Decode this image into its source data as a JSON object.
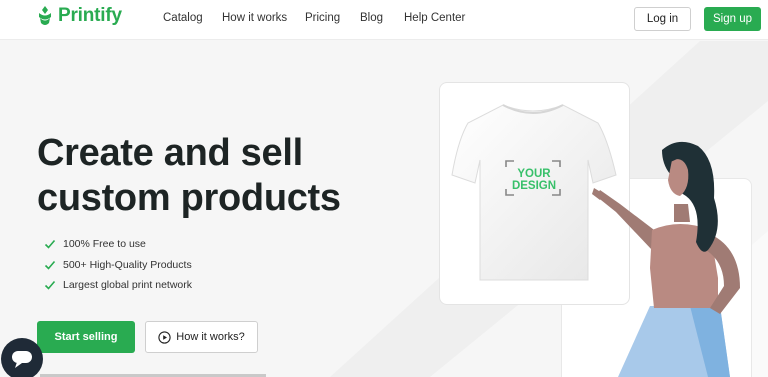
{
  "brand": {
    "name": "Printify",
    "accent": "#29ab51"
  },
  "nav": {
    "items": [
      "Catalog",
      "How it works",
      "Pricing",
      "Blog",
      "Help Center"
    ],
    "login_label": "Log in",
    "signup_label": "Sign up"
  },
  "hero": {
    "title_line1": "Create and sell",
    "title_line2": "custom products",
    "features": [
      "100% Free to use",
      "500+ High-Quality Products",
      "Largest global print network"
    ],
    "start_label": "Start selling",
    "how_label": "How it works?"
  },
  "illustration": {
    "design_line1": "YOUR",
    "design_line2": "DESIGN"
  },
  "icons": [
    "logo-icon",
    "check-icon",
    "play-icon",
    "chat-icon"
  ]
}
